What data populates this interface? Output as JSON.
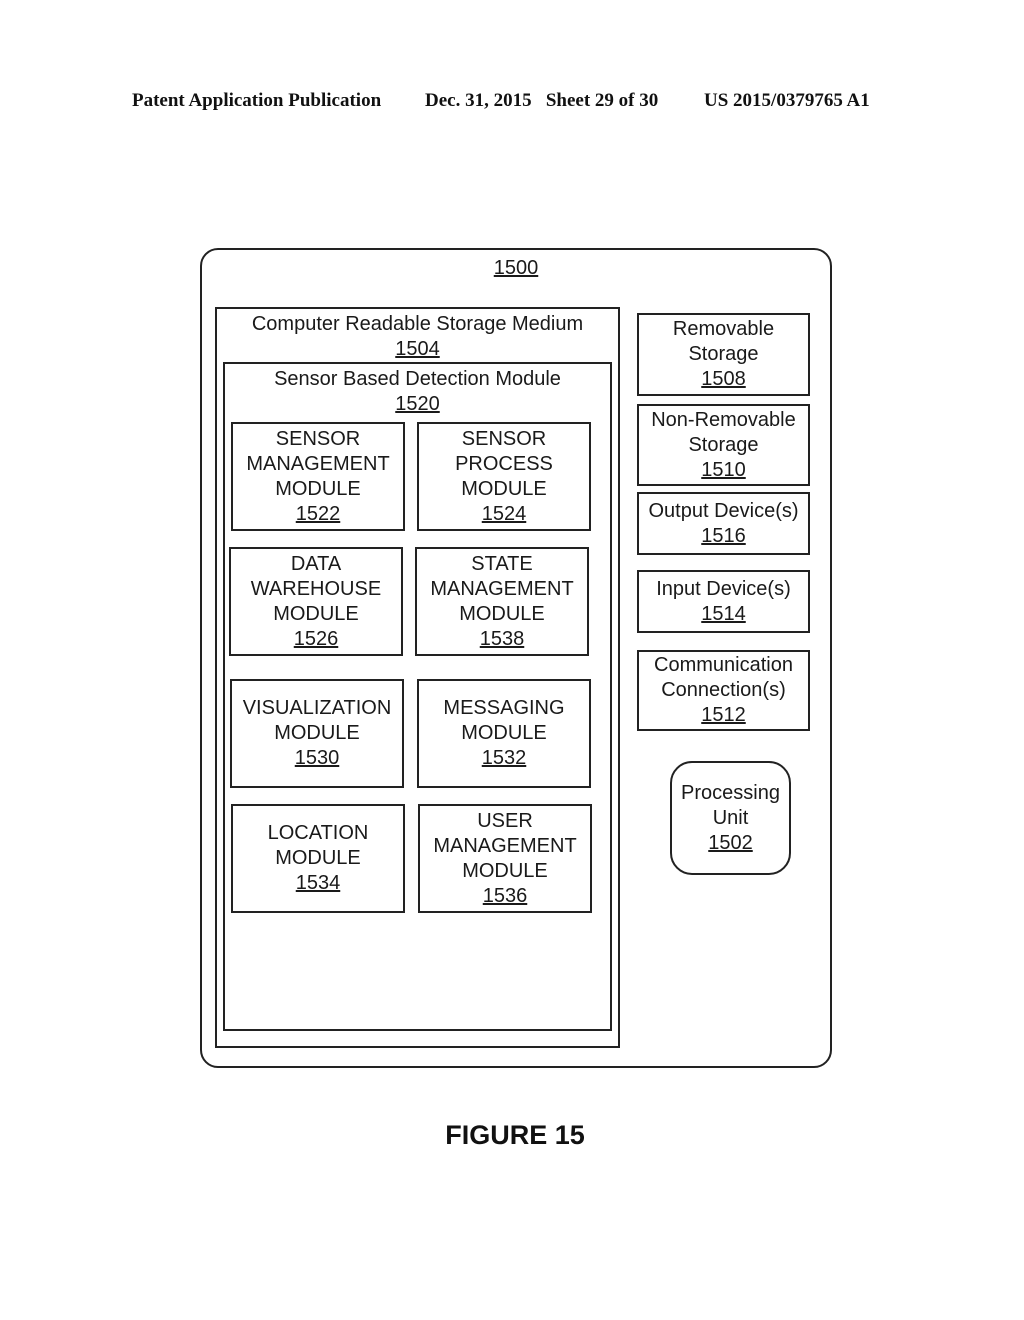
{
  "header": {
    "left": "Patent Application Publication",
    "middle": "Dec. 31, 2015   Sheet 29 of 30",
    "right": "US 2015/0379765 A1"
  },
  "figure": {
    "caption": "FIGURE 15",
    "system": {
      "ref": "1500"
    },
    "storage_medium": {
      "label": "Computer Readable Storage Medium",
      "ref": "1504"
    },
    "detection_module": {
      "label": "Sensor Based Detection Module",
      "ref": "1520"
    },
    "modules": [
      {
        "lines": [
          "SENSOR",
          "MANAGEMENT",
          "MODULE"
        ],
        "ref": "1522"
      },
      {
        "lines": [
          "SENSOR",
          "PROCESS",
          "MODULE"
        ],
        "ref": "1524"
      },
      {
        "lines": [
          "DATA",
          "WAREHOUSE",
          "MODULE"
        ],
        "ref": "1526"
      },
      {
        "lines": [
          "STATE",
          "MANAGEMENT",
          "MODULE"
        ],
        "ref": "1538"
      },
      {
        "lines": [
          "VISUALIZATION",
          "MODULE"
        ],
        "ref": "1530"
      },
      {
        "lines": [
          "MESSAGING",
          "MODULE"
        ],
        "ref": "1532"
      },
      {
        "lines": [
          "LOCATION",
          "MODULE"
        ],
        "ref": "1534"
      },
      {
        "lines": [
          "USER",
          "MANAGEMENT",
          "MODULE"
        ],
        "ref": "1536"
      }
    ],
    "components": [
      {
        "lines": [
          "Removable",
          "Storage"
        ],
        "ref": "1508"
      },
      {
        "lines": [
          "Non-Removable",
          "Storage"
        ],
        "ref": "1510"
      },
      {
        "lines": [
          "Output Device(s)"
        ],
        "ref": "1516"
      },
      {
        "lines": [
          "Input Device(s)"
        ],
        "ref": "1514"
      },
      {
        "lines": [
          "Communication",
          "Connection(s)"
        ],
        "ref": "1512"
      }
    ],
    "processing_unit": {
      "lines": [
        "Processing",
        "Unit"
      ],
      "ref": "1502"
    }
  }
}
